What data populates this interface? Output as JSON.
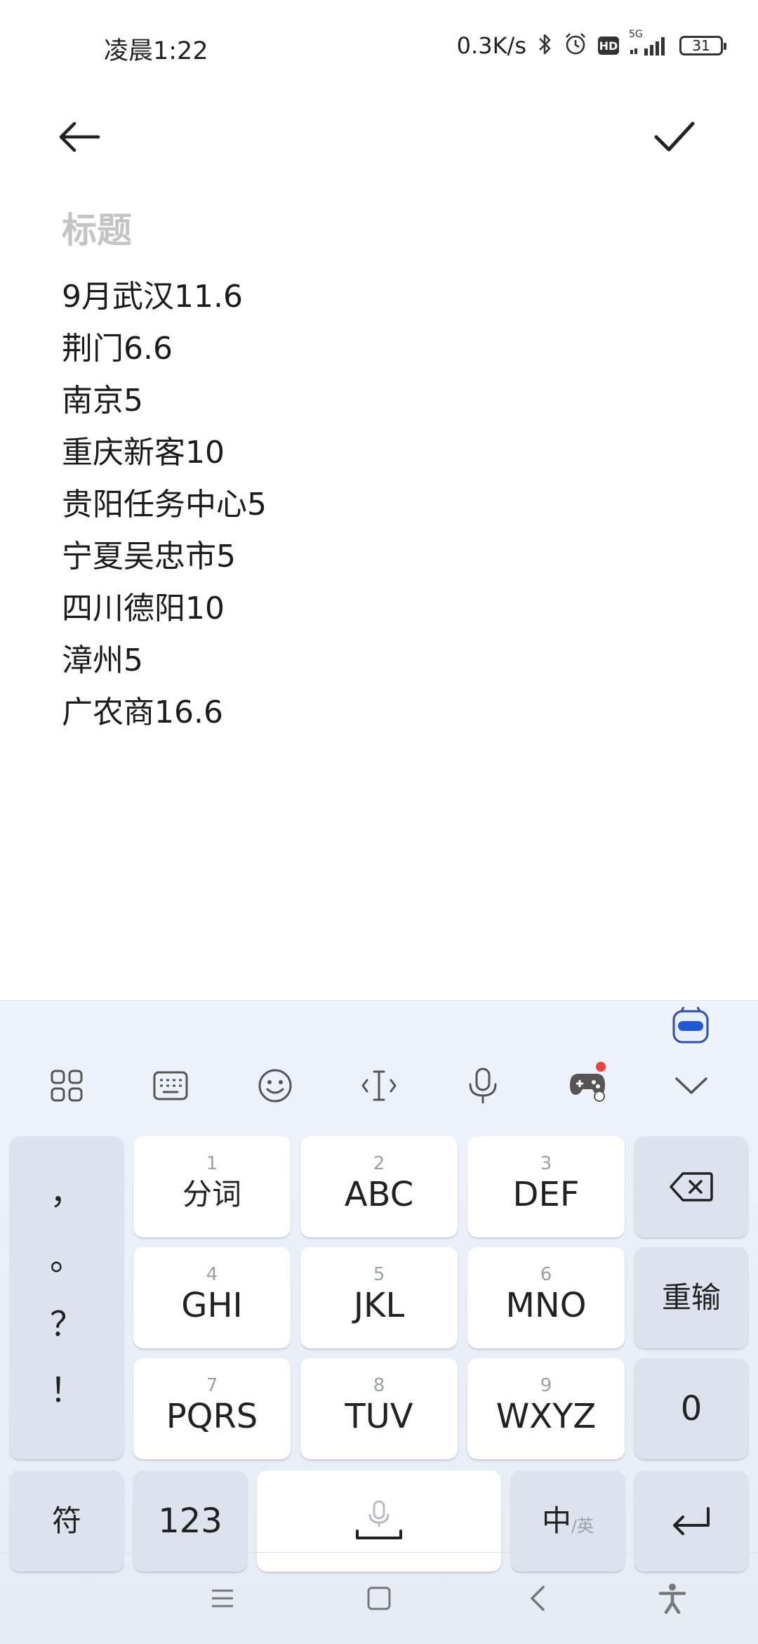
{
  "status_bar": {
    "time": "凌晨1:22",
    "net_speed": "0.3K/s",
    "hd": "HD",
    "network": "5G",
    "battery": "31"
  },
  "header": {
    "back_icon": "arrow-left-icon",
    "confirm_icon": "check-icon"
  },
  "note": {
    "title_placeholder": "标题",
    "lines": [
      "9月武汉11.6",
      "荆门6.6",
      "南京5",
      "重庆新客10",
      "贵阳任务中心5",
      "宁夏吴忠市5",
      "四川德阳10",
      "漳州5",
      "广农商16.6"
    ]
  },
  "keyboard": {
    "toolbar": [
      "grid-apps-icon",
      "keyboard-icon",
      "emoji-icon",
      "cursor-icon",
      "microphone-icon",
      "gamepad-icon",
      "chevron-down-icon"
    ],
    "punctuation": [
      "，",
      "。",
      "？",
      "！"
    ],
    "keys": [
      {
        "num": "1",
        "label": "分词"
      },
      {
        "num": "2",
        "label": "ABC"
      },
      {
        "num": "3",
        "label": "DEF"
      },
      {
        "num": "4",
        "label": "GHI"
      },
      {
        "num": "5",
        "label": "JKL"
      },
      {
        "num": "6",
        "label": "MNO"
      },
      {
        "num": "7",
        "label": "PQRS"
      },
      {
        "num": "8",
        "label": "TUV"
      },
      {
        "num": "9",
        "label": "WXYZ"
      }
    ],
    "reinput": "重输",
    "zero": "0",
    "symbols": "符",
    "numbers": "123",
    "lang_main": "中",
    "lang_alt": "/英",
    "accent": "#3a6fd8"
  },
  "nav": [
    "menu-icon",
    "home-square-icon",
    "back-chevron-icon",
    "accessibility-icon"
  ]
}
